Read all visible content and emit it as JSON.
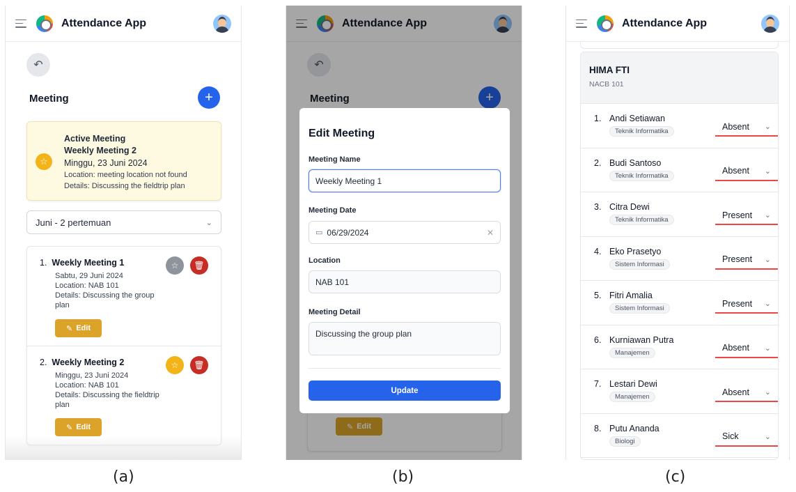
{
  "header": {
    "app_title": "Attendance App"
  },
  "panel_a": {
    "section_title": "Meeting",
    "active_meeting": {
      "label": "Active Meeting",
      "name": "Weekly Meeting 2",
      "date": "Minggu, 23 Juni 2024",
      "location": "Location: meeting location not found",
      "details": "Details: Discussing the fieldtrip plan"
    },
    "month_select": "Juni - 2 pertemuan",
    "meetings": [
      {
        "num": "1.",
        "name": "Weekly Meeting 1",
        "date": "Sabtu, 29 Juni 2024",
        "location": "Location: NAB 101",
        "details": "Details: Discussing the group plan",
        "edit_label": "Edit",
        "active": false
      },
      {
        "num": "2.",
        "name": "Weekly Meeting 2",
        "date": "Minggu, 23 Juni 2024",
        "location": "Location: NAB 101",
        "details": "Details: Discussing the fieldtrip plan",
        "edit_label": "Edit",
        "active": true
      }
    ]
  },
  "panel_b": {
    "section_title": "Meeting",
    "modal_title": "Edit Meeting",
    "fields": {
      "name_label": "Meeting Name",
      "name_value": "Weekly Meeting 1",
      "date_label": "Meeting Date",
      "date_value": "06/29/2024",
      "location_label": "Location",
      "location_value": "NAB 101",
      "detail_label": "Meeting Detail",
      "detail_value": "Discussing the group plan"
    },
    "update_label": "Update",
    "edit_label": "Edit"
  },
  "panel_c": {
    "org_name": "HIMA FTI",
    "org_code": "NACB 101",
    "students": [
      {
        "num": "1.",
        "name": "Andi Setiawan",
        "major": "Teknik Informatika",
        "status": "Absent"
      },
      {
        "num": "2.",
        "name": "Budi Santoso",
        "major": "Teknik Informatika",
        "status": "Absent"
      },
      {
        "num": "3.",
        "name": "Citra Dewi",
        "major": "Teknik Informatika",
        "status": "Present"
      },
      {
        "num": "4.",
        "name": "Eko Prasetyo",
        "major": "Sistem Informasi",
        "status": "Present"
      },
      {
        "num": "5.",
        "name": "Fitri Amalia",
        "major": "Sistem Informasi",
        "status": "Present"
      },
      {
        "num": "6.",
        "name": "Kurniawan Putra",
        "major": "Manajemen",
        "status": "Absent"
      },
      {
        "num": "7.",
        "name": "Lestari Dewi",
        "major": "Manajemen",
        "status": "Absent"
      },
      {
        "num": "8.",
        "name": "Putu Ananda",
        "major": "Biologi",
        "status": "Sick"
      }
    ]
  },
  "captions": {
    "a": "(a)",
    "b": "(b)",
    "c": "(c)"
  },
  "colors": {
    "primary": "#2563eb",
    "warning": "#f2b418",
    "edit": "#dba32a",
    "danger": "#c62d24",
    "active_bg": "#fef9e1",
    "status_underline": "#ef4444"
  },
  "icons": [
    "menu-icon",
    "app-logo-icon",
    "avatar",
    "back-icon",
    "plus-icon",
    "star-icon",
    "trash-icon",
    "edit-icon",
    "calendar-icon",
    "clear-icon",
    "chevron-down-icon"
  ]
}
